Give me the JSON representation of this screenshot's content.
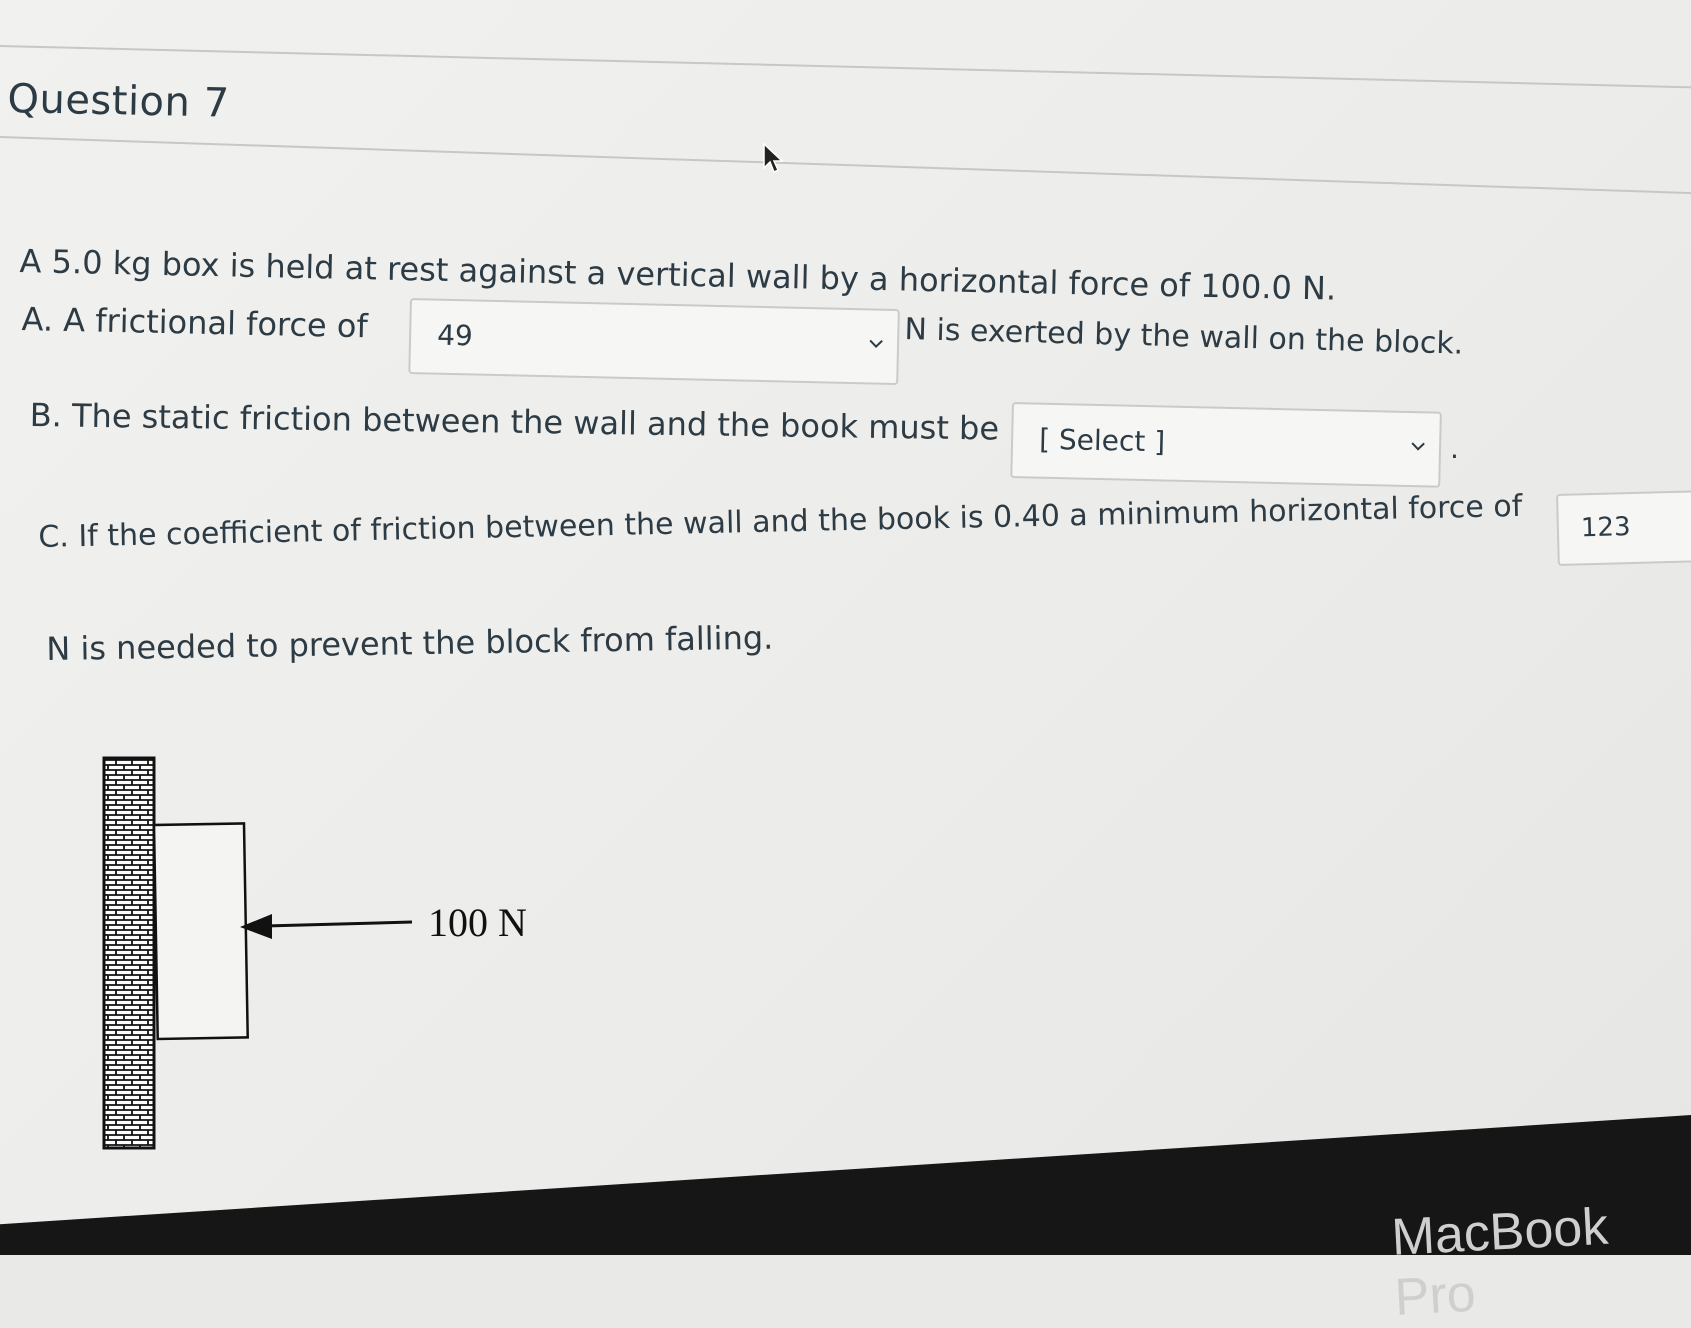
{
  "question": {
    "title": "Question 7"
  },
  "prompt": "A 5.0 kg box is held at rest against a vertical wall by a horizontal force of 100.0 N.",
  "part_a": {
    "before": "A. A frictional force of",
    "select_value": "49",
    "after": "N is exerted by the wall on the block."
  },
  "part_b": {
    "before": "B. The static friction between the wall and the book must be",
    "select_value": "[ Select ]",
    "after": "."
  },
  "part_c": {
    "before": "C. If the coefficient of friction between the wall and the book is 0.40 a minimum horizontal force of",
    "select_value": "123",
    "after": "N is needed to prevent the block from falling."
  },
  "diagram": {
    "force_label": "100 N"
  },
  "device": {
    "brand": "MacBook Pro"
  },
  "colors": {
    "text": "#2d3b45",
    "border": "#c9cbcb",
    "background": "#efefed"
  },
  "icons": [
    "cursor-arrow-icon",
    "chevron-down-icon"
  ]
}
